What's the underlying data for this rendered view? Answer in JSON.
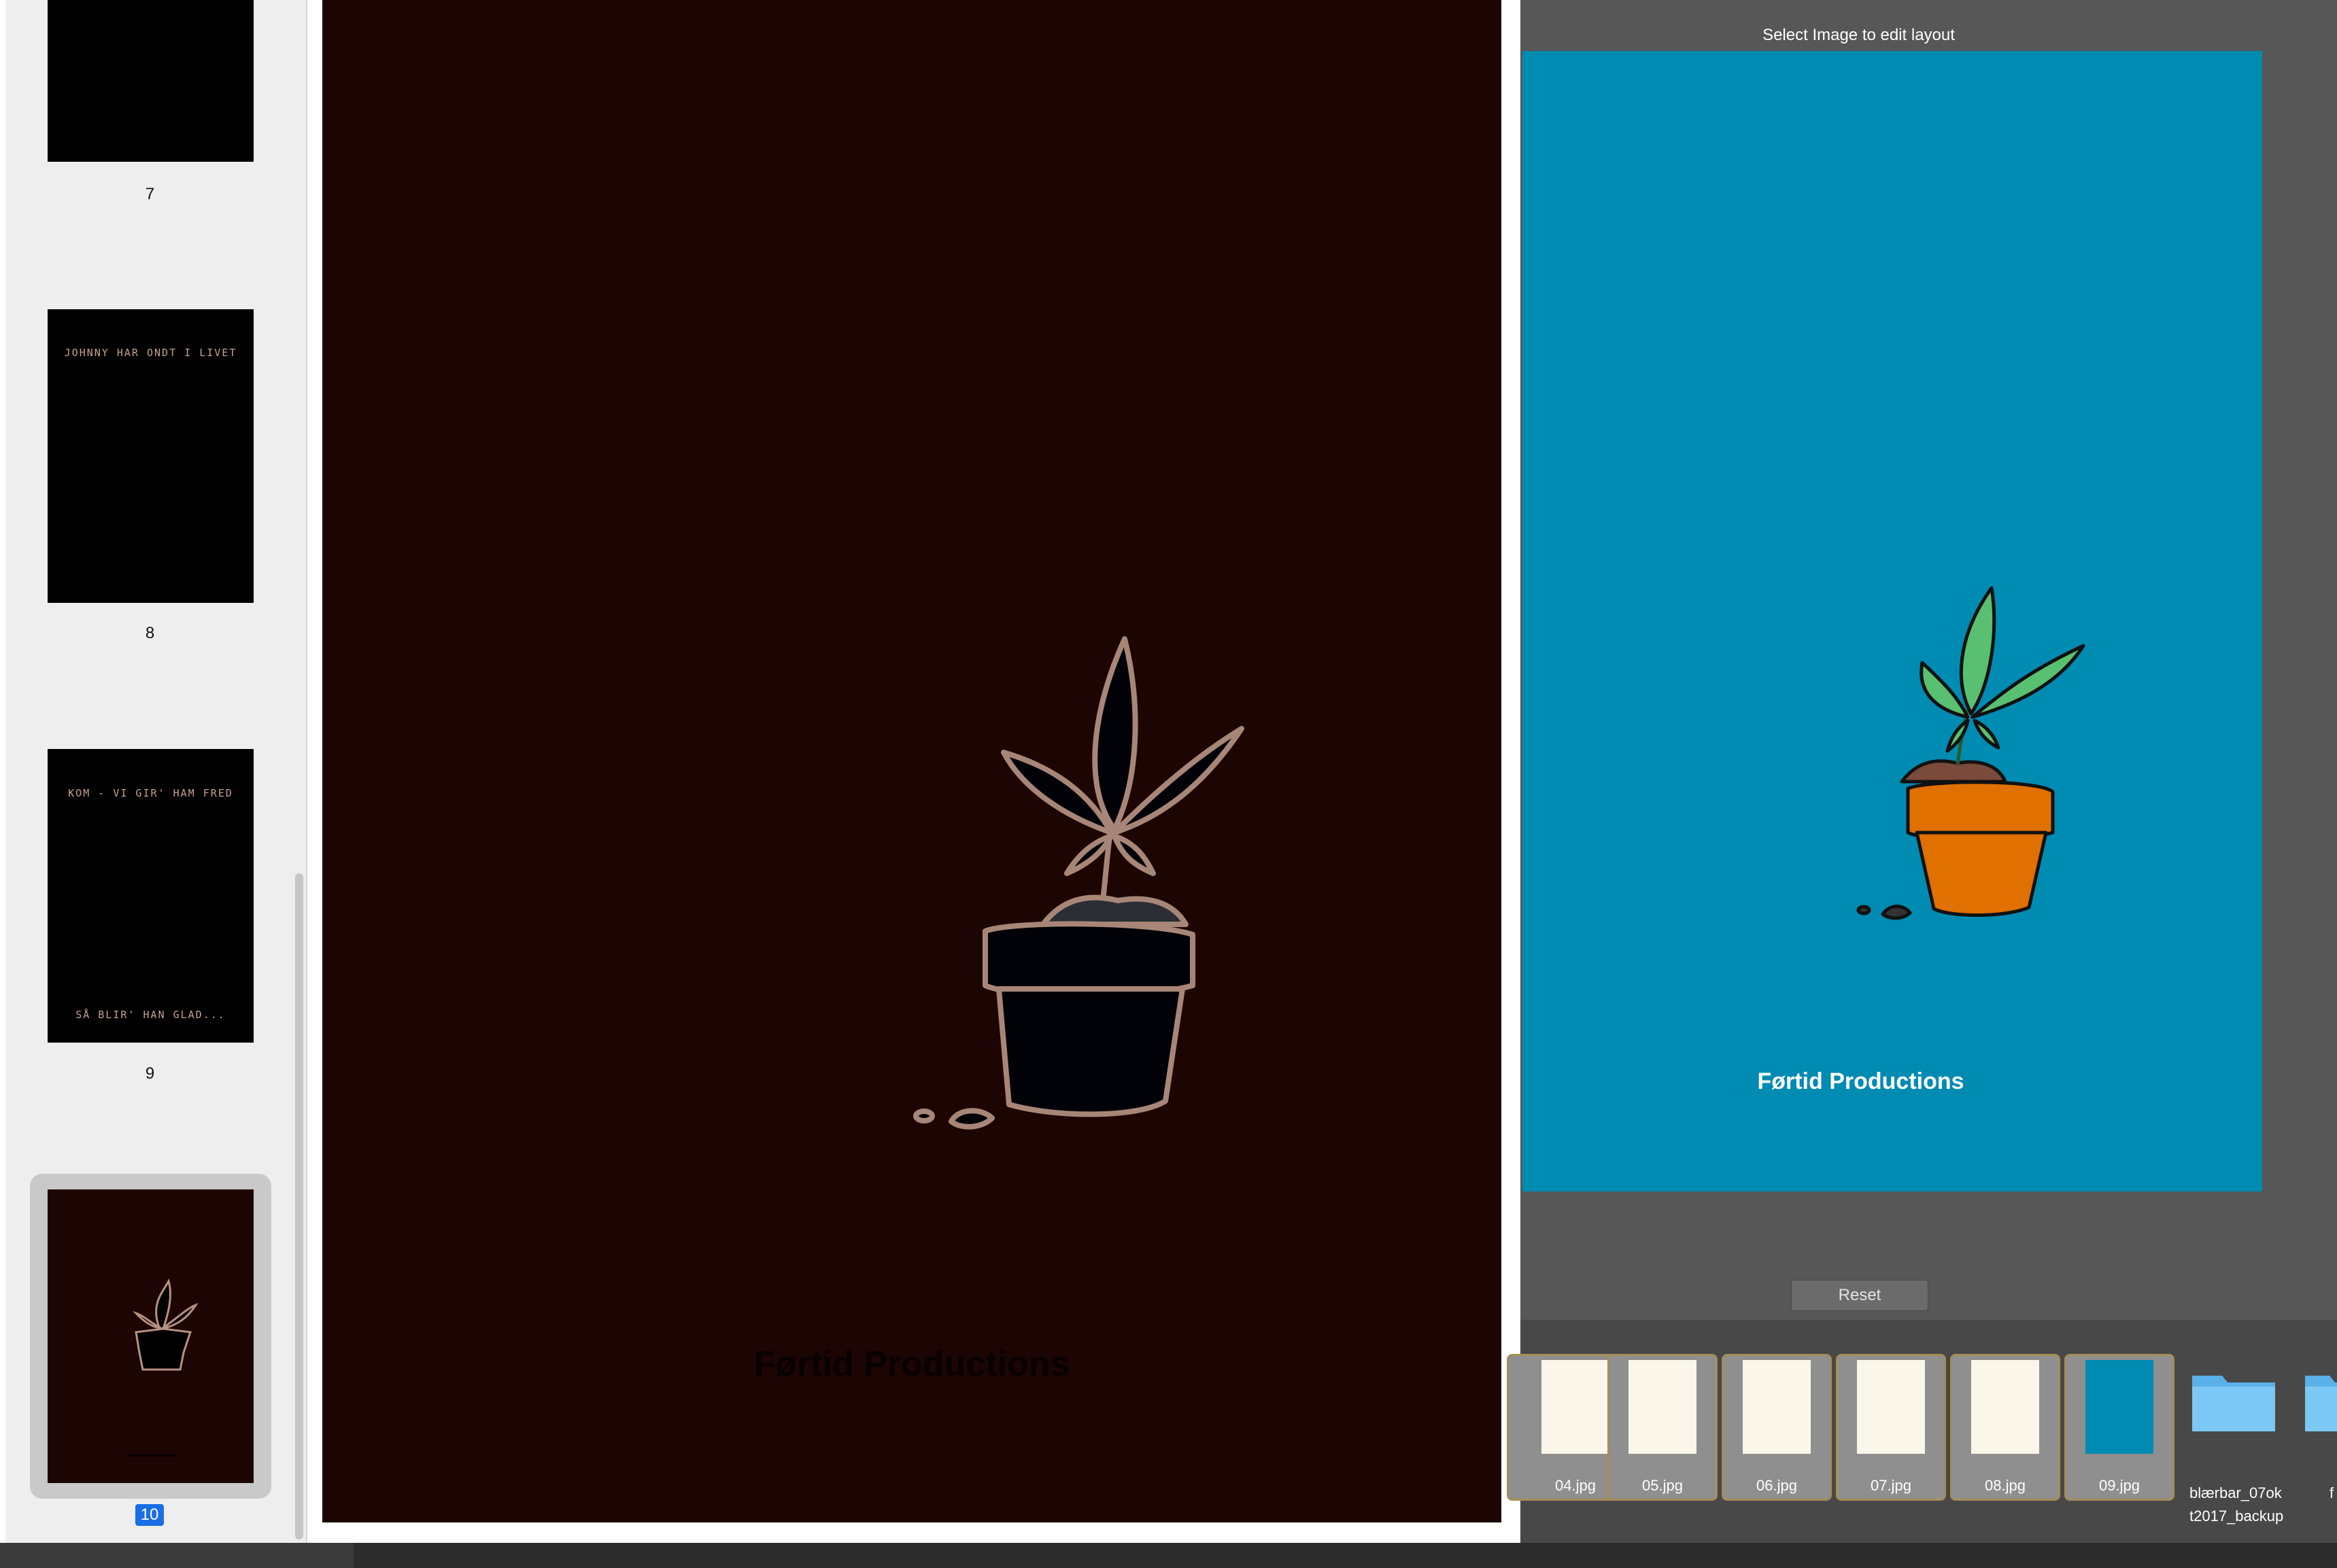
{
  "sidebar": {
    "pages": [
      {
        "number": "7"
      },
      {
        "number": "8",
        "text_top": "JOHNNY HAR ONDT I LIVET"
      },
      {
        "number": "9",
        "text_top": "KOM - VI GIR' HAM FRED",
        "text_bottom": "SÅ BLIR' HAN GLAD..."
      },
      {
        "number": "10",
        "selected": true
      }
    ]
  },
  "main_page": {
    "footer_text": "Førtid Productions",
    "background": "#1c0503"
  },
  "layout_editor": {
    "title": "Select Image to edit layout",
    "preview_text": "Førtid Productions",
    "preview_background": "#008bb3",
    "reset_label": "Reset"
  },
  "browser": {
    "files": [
      {
        "name": "04.jpg"
      },
      {
        "name": "05.jpg"
      },
      {
        "name": "06.jpg"
      },
      {
        "name": "07.jpg"
      },
      {
        "name": "08.jpg"
      },
      {
        "name": "09.jpg"
      }
    ],
    "folders": [
      {
        "name_line1": "blærbar_07ok",
        "name_line2": "t2017_backup"
      },
      {
        "name_line1": "f",
        "name_line2": ""
      }
    ]
  },
  "colors": {
    "accent": "#1a6ee6",
    "tile_border": "#a58e57"
  }
}
